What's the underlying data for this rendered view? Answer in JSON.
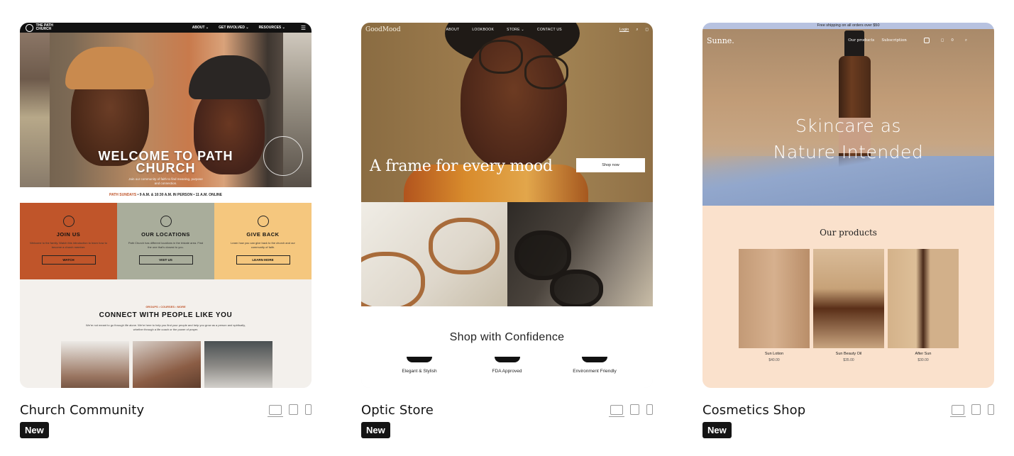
{
  "templates": [
    {
      "name": "Church Community",
      "badge": "New",
      "preview": {
        "logo": "THE PATH CHURCH",
        "nav": [
          "ABOUT ⌄",
          "GET INVOLVED ⌄",
          "RESOURCES ⌄"
        ],
        "hero_title": "WELCOME TO PATH CHURCH",
        "hero_sub": "Join our community of faith to find meaning, purpose and connection.",
        "service_label": "PATH SUNDAYS",
        "service_times": " • 9 A.M. & 10:30 A.M. IN PERSON • 11 A.M. ONLINE",
        "columns": [
          {
            "heading": "JOIN US",
            "text": "Welcome to the family. Watch this introduction to learn how to become a church member.",
            "button": "WATCH",
            "color": "#c0552a"
          },
          {
            "heading": "OUR LOCATIONS",
            "text": "Path Church has different locations in the tristate area. Find the one that's closest to you.",
            "button": "VISIT US",
            "color": "#a9ad9b"
          },
          {
            "heading": "GIVE BACK",
            "text": "Learn how you can give back to the church and our community of faith.",
            "button": "LEARN MORE",
            "color": "#f5c77e"
          }
        ],
        "connect_tag": "GROUPS • COURSES • MORE",
        "connect_title": "CONNECT WITH PEOPLE LIKE YOU",
        "connect_text": "We're not meant to go through life alone. We're here to help you find your people and help you grow as a person and spiritually, whether through a life coach or the power of prayer."
      }
    },
    {
      "name": "Optic Store",
      "badge": "New",
      "preview": {
        "logo": "GoodMood",
        "nav": [
          "ABOUT",
          "LOOKBOOK",
          "STORE ⌄",
          "CONTACT US"
        ],
        "login": "Login",
        "hero_title": "A frame for every mood",
        "cta": "Shop now",
        "section_title": "Shop with Confidence",
        "features": [
          "Elegant & Stylish",
          "FDA Approved",
          "Environment Friendly"
        ]
      }
    },
    {
      "name": "Cosmetics Shop",
      "badge": "New",
      "preview": {
        "banner": "Free shipping on all orders over $50",
        "logo": "Sunne.",
        "nav": [
          "Our products",
          "Subscription"
        ],
        "cart": "0",
        "hero_title_1": "Skincare as",
        "hero_title_2": "Nature Intended",
        "section_title": "Our products",
        "products": [
          {
            "name": "Sun Lotion",
            "price": "$40.00"
          },
          {
            "name": "Sun Beauty Oil",
            "price": "$35.00"
          },
          {
            "name": "After Sun",
            "price": "$30.00"
          }
        ]
      }
    }
  ],
  "colors": {
    "badge_bg": "#141414",
    "church_dark": "#111111",
    "church_accent": "#c0552a",
    "optic_hero": "#9b7a4c",
    "cosmetics_banner": "#b7c2e0",
    "cosmetics_bg": "#fae1cc"
  }
}
